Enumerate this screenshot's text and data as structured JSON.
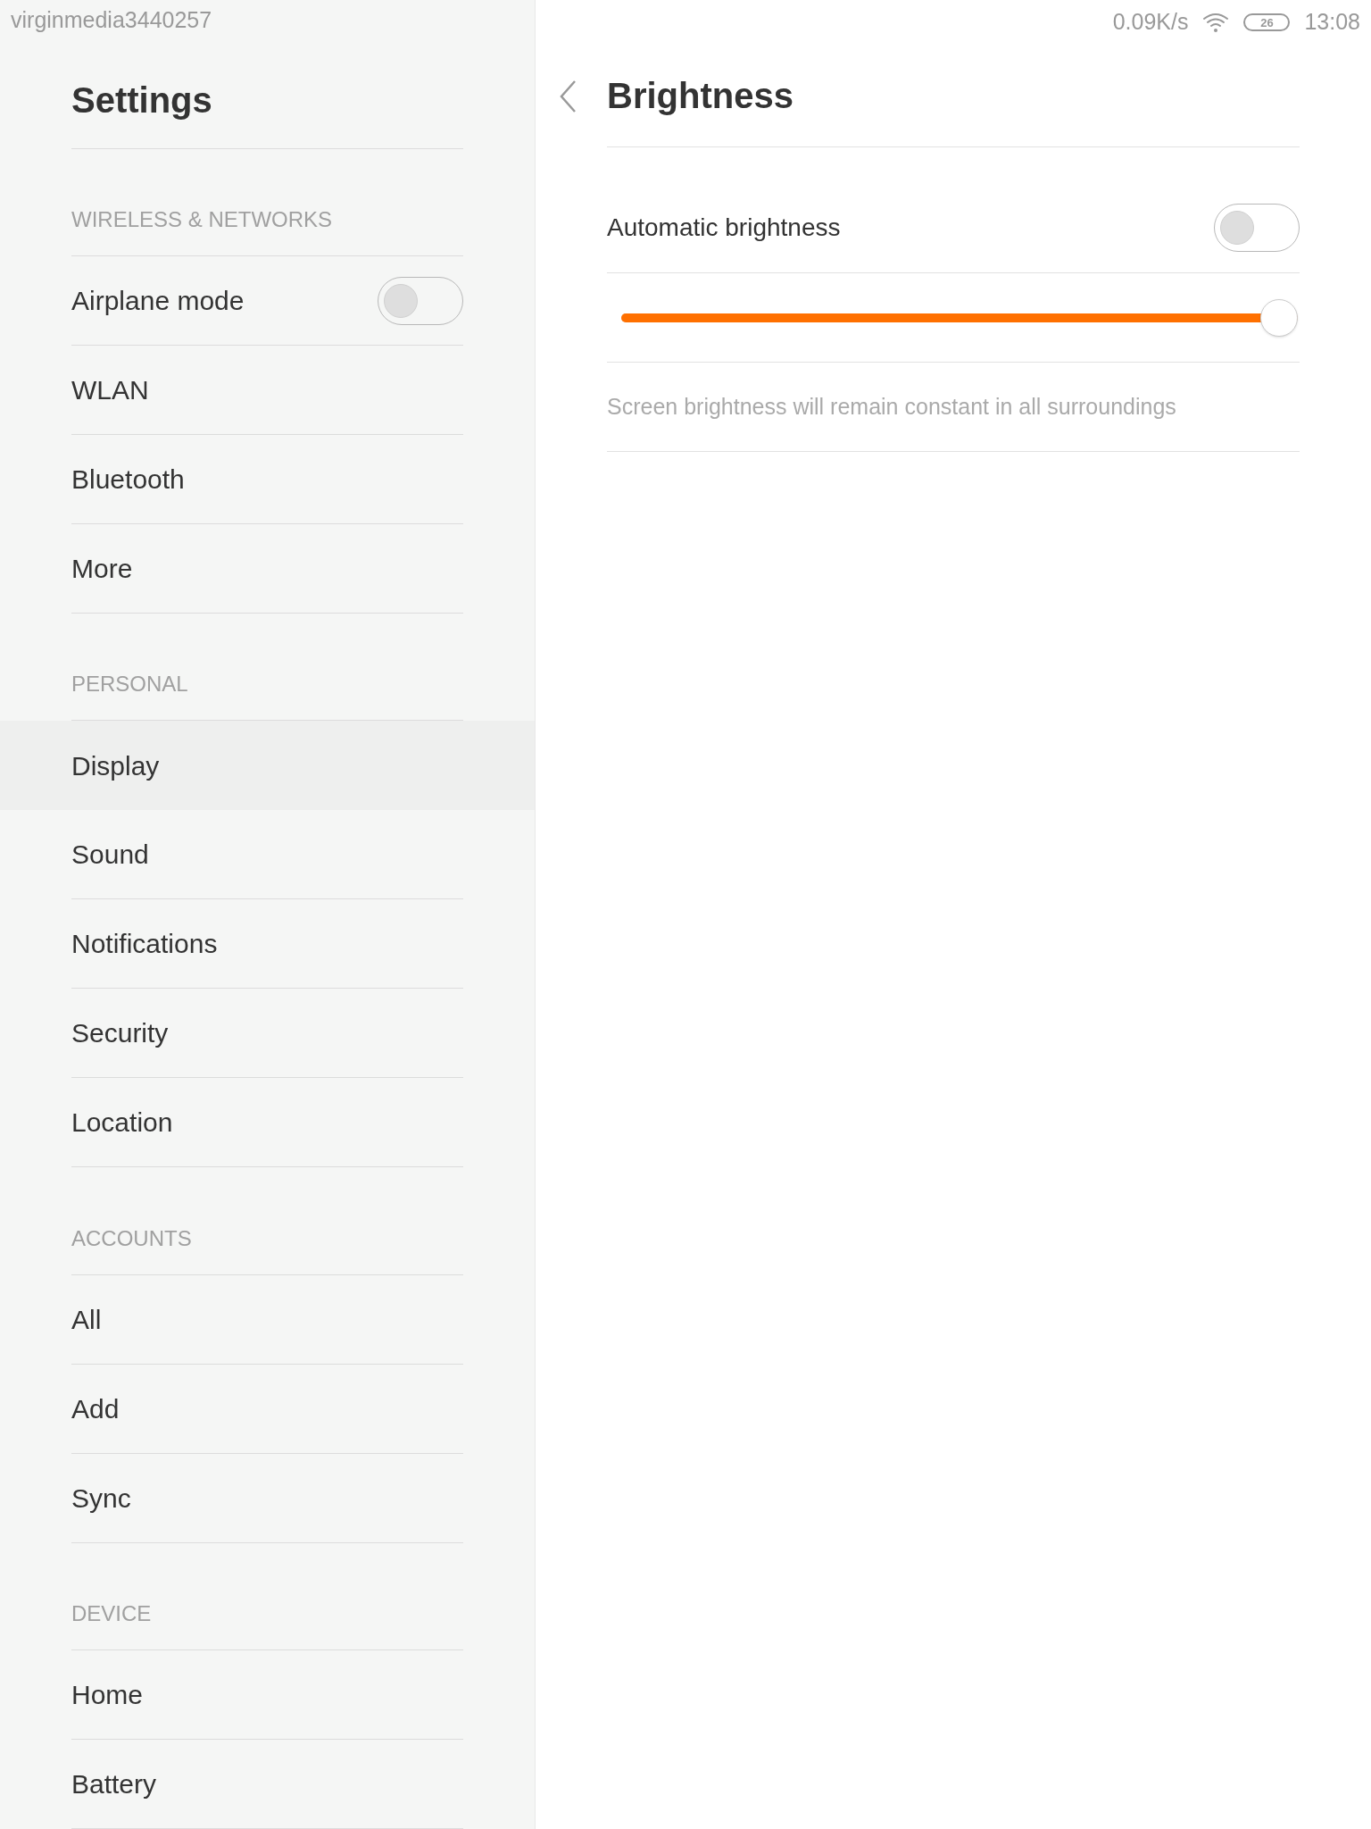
{
  "status_bar": {
    "carrier": "virginmedia3440257",
    "speed": "0.09K/s",
    "battery": "26",
    "time": "13:08"
  },
  "sidebar": {
    "title": "Settings",
    "sections": [
      {
        "header": "WIRELESS & NETWORKS",
        "items": [
          {
            "label": "Airplane mode",
            "kind": "toggle",
            "on": false,
            "selected": false
          },
          {
            "label": "WLAN",
            "kind": "link",
            "selected": false
          },
          {
            "label": "Bluetooth",
            "kind": "link",
            "selected": false
          },
          {
            "label": "More",
            "kind": "link",
            "selected": false
          }
        ]
      },
      {
        "header": "PERSONAL",
        "items": [
          {
            "label": "Display",
            "kind": "link",
            "selected": true
          },
          {
            "label": "Sound",
            "kind": "link",
            "selected": false
          },
          {
            "label": "Notifications",
            "kind": "link",
            "selected": false
          },
          {
            "label": "Security",
            "kind": "link",
            "selected": false
          },
          {
            "label": "Location",
            "kind": "link",
            "selected": false
          }
        ]
      },
      {
        "header": "ACCOUNTS",
        "items": [
          {
            "label": "All",
            "kind": "link",
            "selected": false
          },
          {
            "label": "Add",
            "kind": "link",
            "selected": false
          },
          {
            "label": "Sync",
            "kind": "link",
            "selected": false
          }
        ]
      },
      {
        "header": "DEVICE",
        "items": [
          {
            "label": "Home",
            "kind": "link",
            "selected": false
          },
          {
            "label": "Battery",
            "kind": "link",
            "selected": false
          }
        ]
      }
    ]
  },
  "detail": {
    "title": "Brightness",
    "automatic": {
      "label": "Automatic brightness",
      "on": false
    },
    "slider": {
      "level": 1
    },
    "note": "Screen brightness will remain constant in all surroundings"
  }
}
